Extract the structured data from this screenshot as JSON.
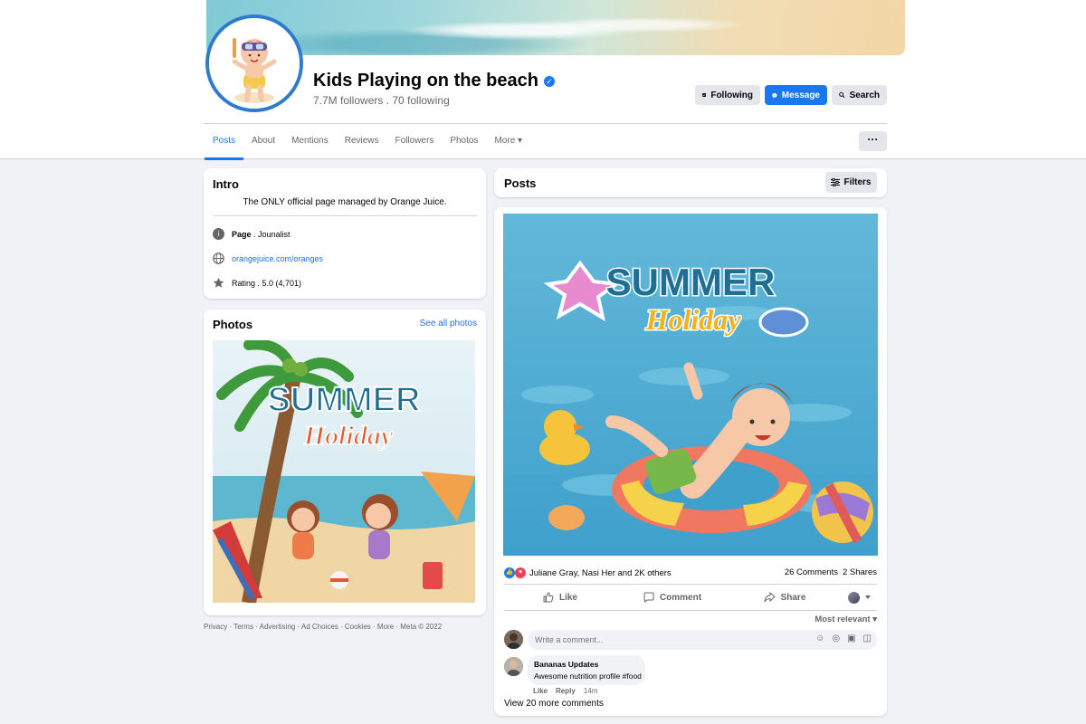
{
  "header": {
    "page_name": "Kids Playing on the beach",
    "followers_line": "7.7M followers . 70 following",
    "buttons": {
      "following": "Following",
      "message": "Message",
      "search": "Search"
    },
    "more_dots": "···"
  },
  "tabs": [
    {
      "label": "Posts",
      "active": true
    },
    {
      "label": "About"
    },
    {
      "label": "Mentions"
    },
    {
      "label": "Reviews"
    },
    {
      "label": "Followers"
    },
    {
      "label": "Photos"
    },
    {
      "label": "More ▾"
    }
  ],
  "intro": {
    "title": "Intro",
    "bio": "The ONLY official page managed by Orange Juice.",
    "page_label": "Page",
    "page_category": " . Jounalist",
    "website": "orangejuice.com/oranges",
    "rating": "Rating . 5.0 (4,701)"
  },
  "photos": {
    "title": "Photos",
    "see_all": "See all photos",
    "image": {
      "line1": "SUMMER",
      "line2": "Holiday"
    }
  },
  "footer": "Privacy · Terms · Advertising · Ad Choices · Cookies · More · Meta © 2022",
  "posts": {
    "title": "Posts",
    "filters": "Filters"
  },
  "post": {
    "image": {
      "line1": "SUMMER",
      "line2": "Holiday"
    },
    "reactions_text": "Juliane Gray, Nasi Her and 2K others",
    "comments_count": "26 Comments",
    "shares_count": "2 Shares",
    "actions": {
      "like": "Like",
      "comment": "Comment",
      "share": "Share"
    },
    "sort": "Most relevant ▾",
    "comment_placeholder": "Write a comment...",
    "comment": {
      "author": "Bananas Updates",
      "text": "Awesome nutrition profile #food",
      "like": "Like",
      "reply": "Reply",
      "time": "14m"
    },
    "view_more": "View 20 more comments"
  },
  "colors": {
    "accent": "#1877f2",
    "avatar_ring": "#2e7ad1"
  }
}
